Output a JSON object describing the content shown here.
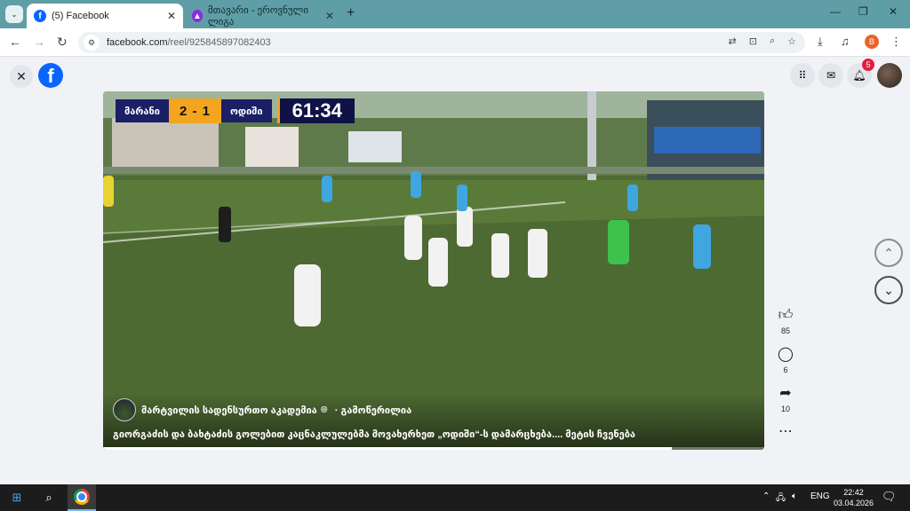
{
  "browser": {
    "tabs": [
      {
        "title": "(5) Facebook",
        "active": true
      },
      {
        "title": "მთავარი - ეროვნული ლიგა",
        "active": false
      }
    ],
    "new_tab_label": "+",
    "url_host": "facebook.com",
    "url_path": "/reel/925845897082403",
    "profile_initial": "B"
  },
  "facebook": {
    "notifications_count": "5",
    "reel": {
      "scoreboard": {
        "home_team": "მარანი",
        "score": "2 - 1",
        "away_team": "ოდიში",
        "time": "61:34"
      },
      "author": "მარტვილის სადენსურთო აკადემია",
      "verified_icon": "globe-icon",
      "follow_label": "· გამოწერილია",
      "caption": "გიორგაძის და ბახტაძის გოლებით კაცნაკლულებმა მოვახერხეთ „ოდიში“-ს დამარცხება.... მეტის ჩვენება",
      "progress_fraction": 0.86
    },
    "actions": {
      "likes": "85",
      "comments": "6",
      "shares": "10"
    }
  },
  "taskbar": {
    "language": "ENG",
    "time": "22:42",
    "date": "03.04.2026"
  }
}
